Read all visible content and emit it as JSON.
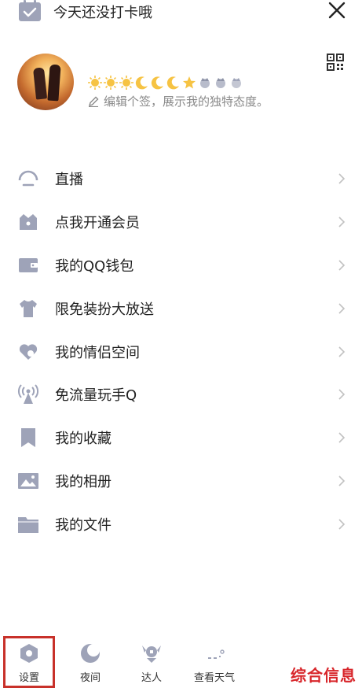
{
  "header": {
    "checkin_text": "今天还没打卡哦",
    "checkin_icon": "calendar-icon",
    "close_icon": "close-icon"
  },
  "profile": {
    "qr_icon": "qrcode-icon",
    "signature_placeholder": "编辑个签，展示我的独特态度。",
    "badges": [
      "sun",
      "sun",
      "sun",
      "moon",
      "moon",
      "moon",
      "star",
      "crown",
      "crown",
      "crown"
    ]
  },
  "menu": {
    "items": [
      {
        "label": "直播",
        "icon": "live-icon"
      },
      {
        "label": "点我开通会员",
        "icon": "vip-icon"
      },
      {
        "label": "我的QQ钱包",
        "icon": "wallet-icon"
      },
      {
        "label": "限免装扮大放送",
        "icon": "shirt-icon"
      },
      {
        "label": "我的情侣空间",
        "icon": "heart-icon"
      },
      {
        "label": "免流量玩手Q",
        "icon": "signal-tower-icon"
      },
      {
        "label": "我的收藏",
        "icon": "bookmark-icon"
      },
      {
        "label": "我的相册",
        "icon": "album-icon"
      },
      {
        "label": "我的文件",
        "icon": "folder-icon"
      }
    ]
  },
  "bottom": {
    "tabs": [
      {
        "label": "设置",
        "icon": "settings-icon"
      },
      {
        "label": "夜间",
        "icon": "night-mode-icon"
      },
      {
        "label": "达人",
        "icon": "expert-icon"
      },
      {
        "label": "查看天气",
        "icon": "weather-icon"
      }
    ]
  },
  "watermark": "综合信息",
  "colors": {
    "icon_gray": "#9ea3b8",
    "highlight_red": "#c8312a",
    "watermark_red": "#d8262b"
  }
}
